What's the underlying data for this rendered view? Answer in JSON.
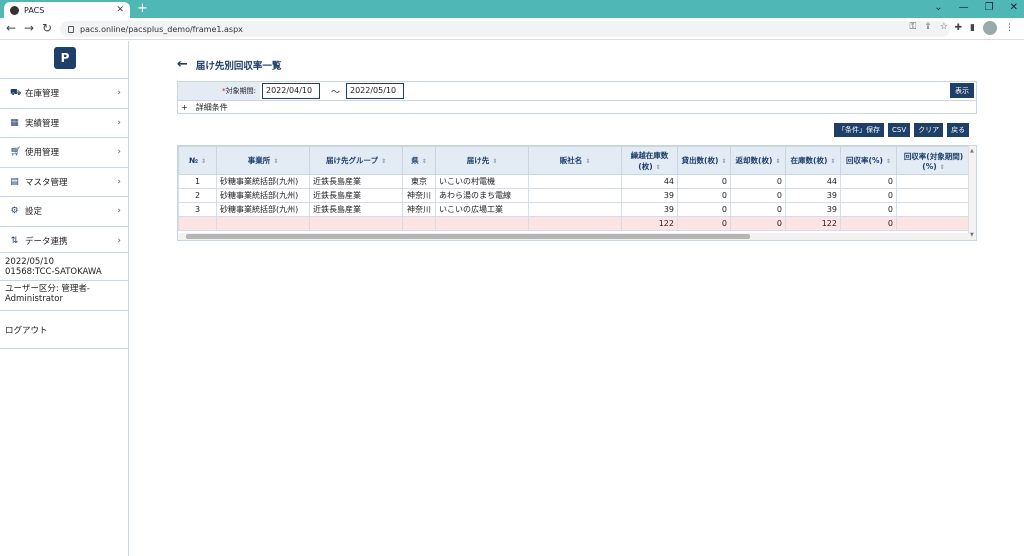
{
  "browser": {
    "tab_title": "PACS",
    "new_tab": "+",
    "url": "pacs.online/pacsplus_demo/frame1.aspx"
  },
  "sidebar": {
    "logo_letter": "P",
    "items": [
      {
        "label": "在庫管理",
        "icon": "forklift-icon"
      },
      {
        "label": "実績管理",
        "icon": "table-icon"
      },
      {
        "label": "使用管理",
        "icon": "cart-icon"
      },
      {
        "label": "マスタ管理",
        "icon": "document-icon"
      },
      {
        "label": "設定",
        "icon": "gear-icon"
      },
      {
        "label": "データ連携",
        "icon": "transfer-icon"
      }
    ],
    "info": {
      "date": "2022/05/10",
      "user": "01568:TCC-SATOKAWA",
      "user_type": "ユーザー区分: 管理者-Administrator",
      "logout": "ログアウト"
    }
  },
  "page": {
    "title": "届け先別回収率一覧",
    "filter": {
      "required_mark": "*",
      "period_label": "対象期間:",
      "date_from": "2022/04/10",
      "separator": "～",
      "date_to": "2022/05/10",
      "show_button": "表示"
    },
    "detail": {
      "expand": "+",
      "label": "詳細条件"
    },
    "actions": {
      "save": "「条件」保存",
      "csv": "CSV",
      "clear": "クリア",
      "back": "戻る"
    },
    "table": {
      "headers": [
        "№",
        "事業所",
        "届け先グループ",
        "県",
        "届け先",
        "販社名",
        "繰越在庫数(枚)",
        "貸出数(枚)",
        "返却数(枚)",
        "在庫数(枚)",
        "回収率(%)",
        "回収率(対象期間)(%)"
      ],
      "rows": [
        [
          "1",
          "砂糖事業統括部(九州)",
          "近鉄長島産業",
          "東京",
          "いこいの村電機",
          "",
          "44",
          "0",
          "0",
          "44",
          "0",
          ""
        ],
        [
          "2",
          "砂糖事業統括部(九州)",
          "近鉄長島産業",
          "神奈川",
          "あわら湯のまち電線",
          "",
          "39",
          "0",
          "0",
          "39",
          "0",
          ""
        ],
        [
          "3",
          "砂糖事業統括部(九州)",
          "近鉄長島産業",
          "神奈川",
          "いこいの広場工業",
          "",
          "39",
          "0",
          "0",
          "39",
          "0",
          ""
        ]
      ],
      "total": [
        "",
        "",
        "",
        "",
        "",
        "",
        "122",
        "0",
        "0",
        "122",
        "0",
        ""
      ]
    }
  }
}
